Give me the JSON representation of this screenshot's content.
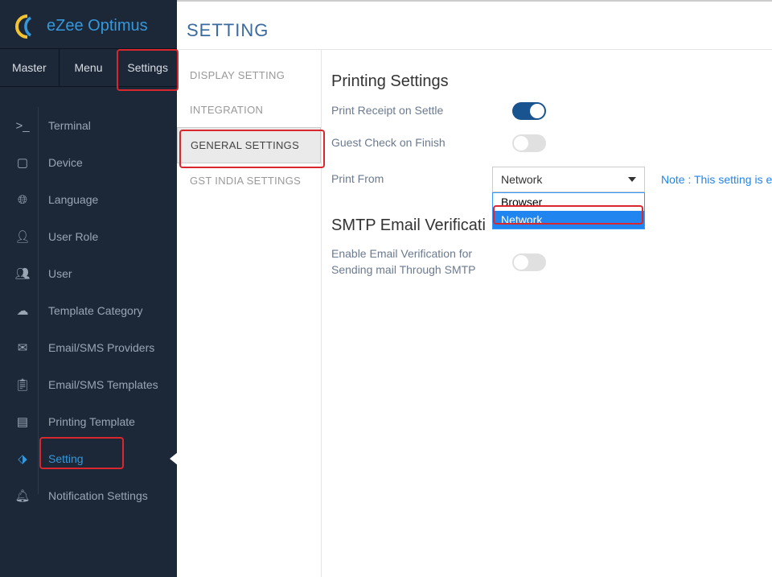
{
  "logo": {
    "text": "eZee Optimus"
  },
  "topNav": [
    {
      "label": "Master"
    },
    {
      "label": "Menu"
    },
    {
      "label": "Settings"
    }
  ],
  "sidebar": [
    {
      "label": "Terminal"
    },
    {
      "label": "Device"
    },
    {
      "label": "Language"
    },
    {
      "label": "User Role"
    },
    {
      "label": "User"
    },
    {
      "label": "Template Category"
    },
    {
      "label": "Email/SMS Providers"
    },
    {
      "label": "Email/SMS Templates"
    },
    {
      "label": "Printing Template"
    },
    {
      "label": "Setting"
    },
    {
      "label": "Notification Settings"
    }
  ],
  "mainTitle": "SETTING",
  "settingsNav": [
    {
      "label": "DISPLAY SETTING"
    },
    {
      "label": "INTEGRATION"
    },
    {
      "label": "GENERAL SETTINGS"
    },
    {
      "label": "GST INDIA SETTINGS"
    }
  ],
  "printing": {
    "title": "Printing Settings",
    "receiptLabel": "Print Receipt on Settle",
    "guestLabel": "Guest Check on Finish",
    "printFromLabel": "Print From",
    "dropdownValue": "Network",
    "options": [
      "Browser",
      "Network"
    ],
    "note": "Note : This setting is e"
  },
  "smtp": {
    "title": "SMTP Email Verificati",
    "enableLabel": "Enable Email Verification for Sending mail Through SMTP"
  }
}
